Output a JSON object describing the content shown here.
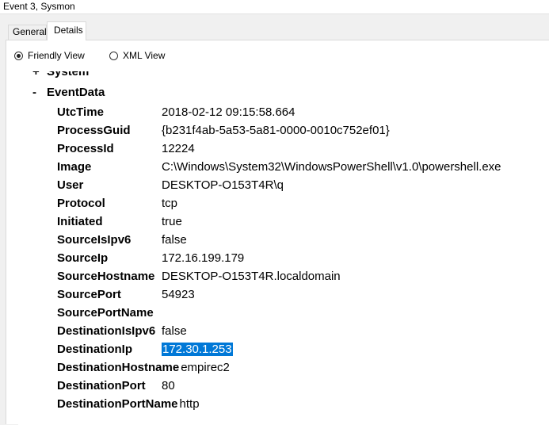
{
  "window": {
    "title": "Event 3, Sysmon"
  },
  "tabs": [
    {
      "label": "General",
      "active": false
    },
    {
      "label": "Details",
      "active": true
    }
  ],
  "view": {
    "friendly_label": "Friendly View",
    "xml_label": "XML View",
    "selected": "Friendly View"
  },
  "tree": {
    "system": {
      "sign": "+",
      "label": "System"
    },
    "eventdata": {
      "sign": "-",
      "label": "EventData"
    }
  },
  "rows": [
    {
      "key": "UtcTime",
      "value": "2018-02-12 09:15:58.664"
    },
    {
      "key": "ProcessGuid",
      "value": "{b231f4ab-5a53-5a81-0000-0010c752ef01}"
    },
    {
      "key": "ProcessId",
      "value": "12224"
    },
    {
      "key": "Image",
      "value": "C:\\Windows\\System32\\WindowsPowerShell\\v1.0\\powershell.exe"
    },
    {
      "key": "User",
      "value": "DESKTOP-O153T4R\\q"
    },
    {
      "key": "Protocol",
      "value": "tcp"
    },
    {
      "key": "Initiated",
      "value": "true"
    },
    {
      "key": "SourceIsIpv6",
      "value": "false"
    },
    {
      "key": "SourceIp",
      "value": "172.16.199.179"
    },
    {
      "key": "SourceHostname",
      "value": "DESKTOP-O153T4R.localdomain"
    },
    {
      "key": "SourcePort",
      "value": "54923"
    },
    {
      "key": "SourcePortName",
      "value": ""
    },
    {
      "key": "DestinationIsIpv6",
      "value": "false"
    },
    {
      "key": "DestinationIp",
      "value": "172.30.1.253",
      "selected": true
    },
    {
      "key": "DestinationHostname",
      "value": "empirec2"
    },
    {
      "key": "DestinationPort",
      "value": "80"
    },
    {
      "key": "DestinationPortName",
      "value": "http"
    }
  ],
  "colors": {
    "selection": "#0078d7",
    "panel_bg": "#ffffff",
    "chrome_bg": "#f0f0f0"
  }
}
